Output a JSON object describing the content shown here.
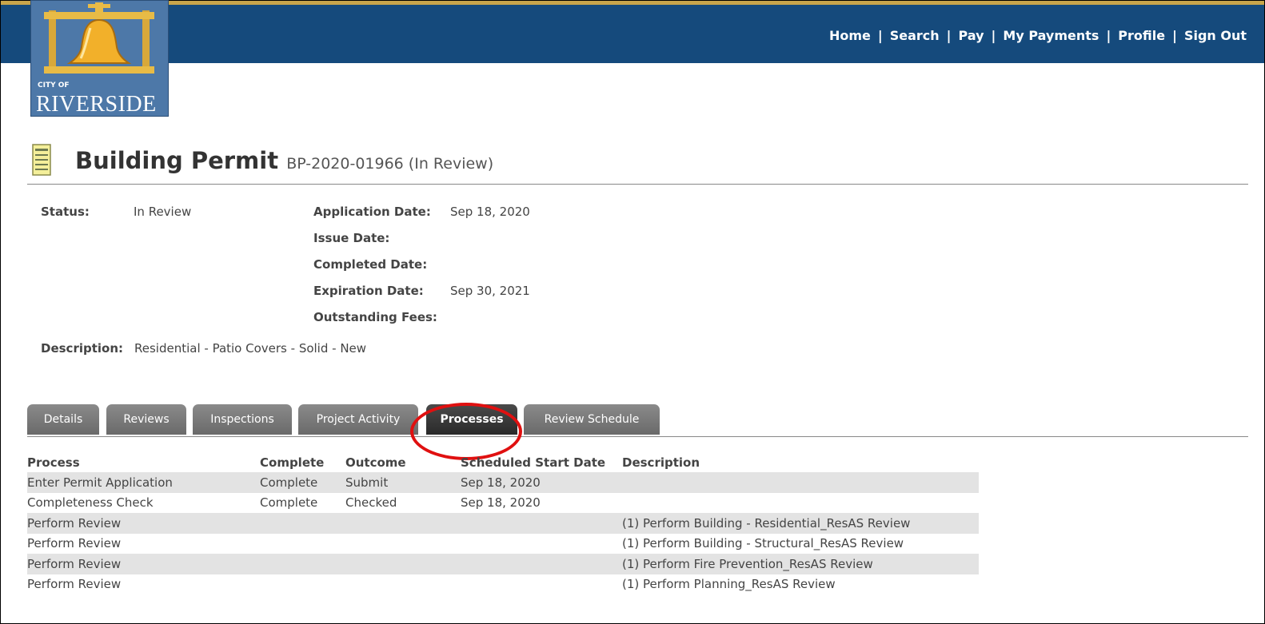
{
  "header": {
    "logo": {
      "city_of": "CITY OF",
      "name": "RIVERSIDE",
      "icon": "bell-icon"
    },
    "nav": [
      "Home",
      "Search",
      "Pay",
      "My Payments",
      "Profile",
      "Sign Out"
    ],
    "colors": {
      "bar": "#154a7c",
      "accent": "#c8a54b"
    }
  },
  "permit": {
    "title": "Building Permit",
    "number_status": "BP-2020-01966 (In Review)",
    "icon": "document-icon"
  },
  "summary": {
    "status_label": "Status:",
    "status_value": "In Review",
    "application_date_label": "Application Date:",
    "application_date_value": "Sep 18, 2020",
    "issue_date_label": "Issue Date:",
    "issue_date_value": "",
    "completed_date_label": "Completed Date:",
    "completed_date_value": "",
    "expiration_date_label": "Expiration Date:",
    "expiration_date_value": "Sep 30, 2021",
    "outstanding_fees_label": "Outstanding Fees:",
    "outstanding_fees_value": "",
    "description_label": "Description:",
    "description_value": "Residential - Patio Covers - Solid - New"
  },
  "tabs": [
    {
      "label": "Details",
      "active": false
    },
    {
      "label": "Reviews",
      "active": false
    },
    {
      "label": "Inspections",
      "active": false
    },
    {
      "label": "Project Activity",
      "active": false
    },
    {
      "label": "Processes",
      "active": true
    },
    {
      "label": "Review Schedule",
      "active": false
    }
  ],
  "processes": {
    "columns": [
      "Process",
      "Complete",
      "Outcome",
      "Scheduled Start Date",
      "Description"
    ],
    "rows": [
      [
        "Enter Permit Application",
        "Complete",
        "Submit",
        "Sep 18, 2020",
        ""
      ],
      [
        "Completeness Check",
        "Complete",
        "Checked",
        "Sep 18, 2020",
        ""
      ],
      [
        "Perform Review",
        "",
        "",
        "",
        "(1) Perform Building - Residential_ResAS Review"
      ],
      [
        "Perform Review",
        "",
        "",
        "",
        "(1) Perform Building - Structural_ResAS Review"
      ],
      [
        "Perform Review",
        "",
        "",
        "",
        "(1) Perform Fire Prevention_ResAS Review"
      ],
      [
        "Perform Review",
        "",
        "",
        "",
        "(1) Perform Planning_ResAS Review"
      ]
    ]
  }
}
